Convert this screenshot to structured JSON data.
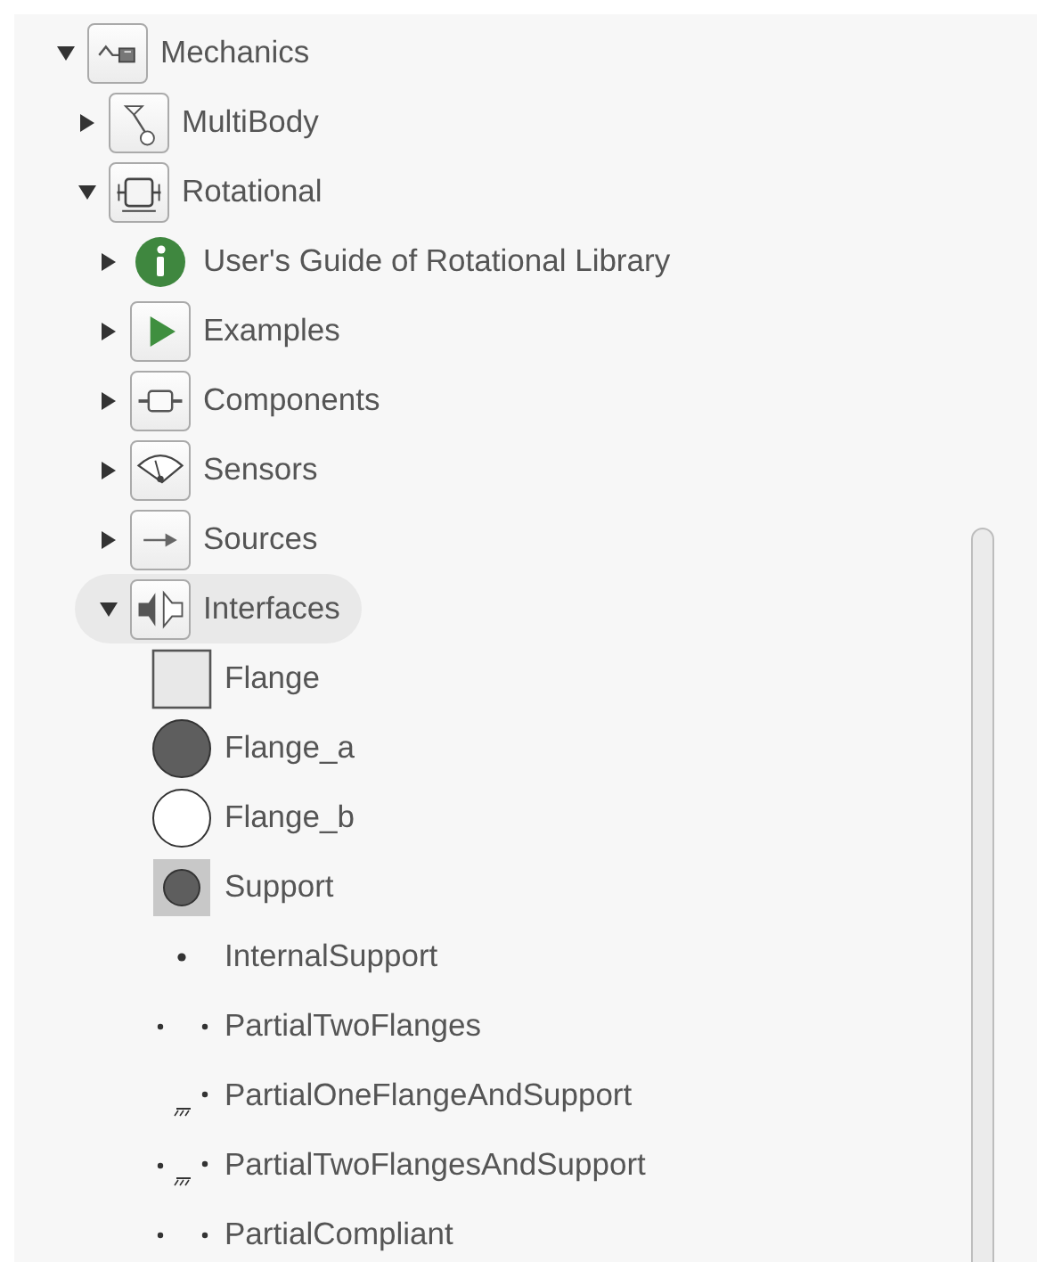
{
  "tree": [
    {
      "label": "Mechanics",
      "kind": "mechanics",
      "expanded": true,
      "selected": false,
      "children": [
        {
          "label": "MultiBody",
          "kind": "multibody",
          "expanded": false,
          "selected": false
        },
        {
          "label": "Rotational",
          "kind": "rotational",
          "expanded": true,
          "selected": false,
          "children": [
            {
              "label": "User's Guide of Rotational Library",
              "kind": "info",
              "expanded": false,
              "selected": false
            },
            {
              "label": "Examples",
              "kind": "examples",
              "expanded": false,
              "selected": false
            },
            {
              "label": "Components",
              "kind": "components",
              "expanded": false,
              "selected": false
            },
            {
              "label": "Sensors",
              "kind": "sensors",
              "expanded": false,
              "selected": false
            },
            {
              "label": "Sources",
              "kind": "sources",
              "expanded": false,
              "selected": false
            },
            {
              "label": "Interfaces",
              "kind": "interfaces",
              "expanded": true,
              "selected": true,
              "children": [
                {
                  "label": "Flange",
                  "kind": "flange",
                  "selected": false
                },
                {
                  "label": "Flange_a",
                  "kind": "flange_a",
                  "selected": false
                },
                {
                  "label": "Flange_b",
                  "kind": "flange_b",
                  "selected": false
                },
                {
                  "label": "Support",
                  "kind": "support",
                  "selected": false
                },
                {
                  "label": "InternalSupport",
                  "kind": "internal_support",
                  "selected": false
                },
                {
                  "label": "PartialTwoFlanges",
                  "kind": "two_dots",
                  "selected": false
                },
                {
                  "label": "PartialOneFlangeAndSupport",
                  "kind": "ground_dot",
                  "selected": false
                },
                {
                  "label": "PartialTwoFlangesAndSupport",
                  "kind": "dots_ground",
                  "selected": false
                },
                {
                  "label": "PartialCompliant",
                  "kind": "two_dots",
                  "selected": false
                }
              ]
            }
          ]
        }
      ]
    }
  ]
}
